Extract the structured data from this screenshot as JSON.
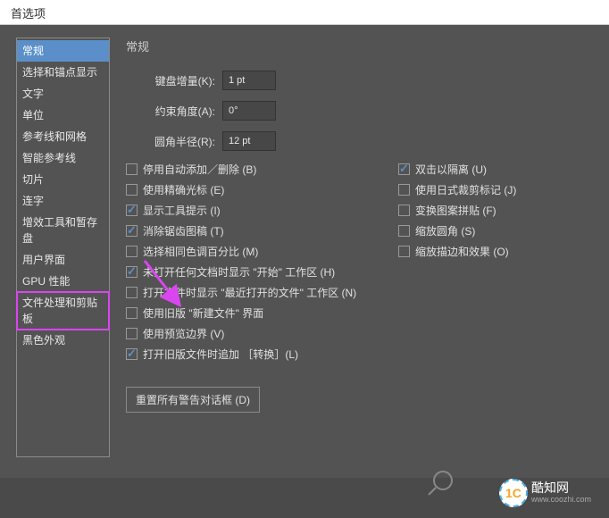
{
  "title": "首选项",
  "sidebar": {
    "items": [
      {
        "label": "常规",
        "active": true
      },
      {
        "label": "选择和锚点显示"
      },
      {
        "label": "文字"
      },
      {
        "label": "单位"
      },
      {
        "label": "参考线和网格"
      },
      {
        "label": "智能参考线"
      },
      {
        "label": "切片"
      },
      {
        "label": "连字"
      },
      {
        "label": "增效工具和暂存盘"
      },
      {
        "label": "用户界面"
      },
      {
        "label": "GPU 性能"
      },
      {
        "label": "文件处理和剪贴板",
        "highlighted": true
      },
      {
        "label": "黑色外观"
      }
    ]
  },
  "panel": {
    "title": "常规",
    "fields": {
      "key_increment": {
        "label": "键盘增量(K):",
        "value": "1 pt"
      },
      "constrain_angle": {
        "label": "约束角度(A):",
        "value": "0°"
      },
      "corner_radius": {
        "label": "圆角半径(R):",
        "value": "12 pt"
      }
    },
    "checks_left": [
      {
        "label": "停用自动添加／删除 (B)",
        "checked": false
      },
      {
        "label": "使用精确光标 (E)",
        "checked": false
      },
      {
        "label": "显示工具提示 (I)",
        "checked": true
      },
      {
        "label": "消除锯齿图稿 (T)",
        "checked": true
      },
      {
        "label": "选择相同色调百分比 (M)",
        "checked": false
      },
      {
        "label": "未打开任何文档时显示 \"开始\" 工作区 (H)",
        "checked": true
      },
      {
        "label": "打开文件时显示 \"最近打开的文件\" 工作区 (N)",
        "checked": false
      },
      {
        "label": "使用旧版 \"新建文件\" 界面",
        "checked": false
      },
      {
        "label": "使用预览边界 (V)",
        "checked": false
      },
      {
        "label": "打开旧版文件时追加 ［转换］(L)",
        "checked": true
      }
    ],
    "checks_right": [
      {
        "label": "双击以隔离 (U)",
        "checked": true
      },
      {
        "label": "使用日式裁剪标记 (J)",
        "checked": false
      },
      {
        "label": "变换图案拼贴 (F)",
        "checked": false
      },
      {
        "label": "缩放圆角 (S)",
        "checked": false
      },
      {
        "label": "缩放描边和效果 (O)",
        "checked": false
      }
    ],
    "reset_button": "重置所有警告对话框 (D)"
  },
  "watermark": {
    "badge": "1C",
    "text": "酷知网",
    "sub": "www.coozhi.com"
  }
}
